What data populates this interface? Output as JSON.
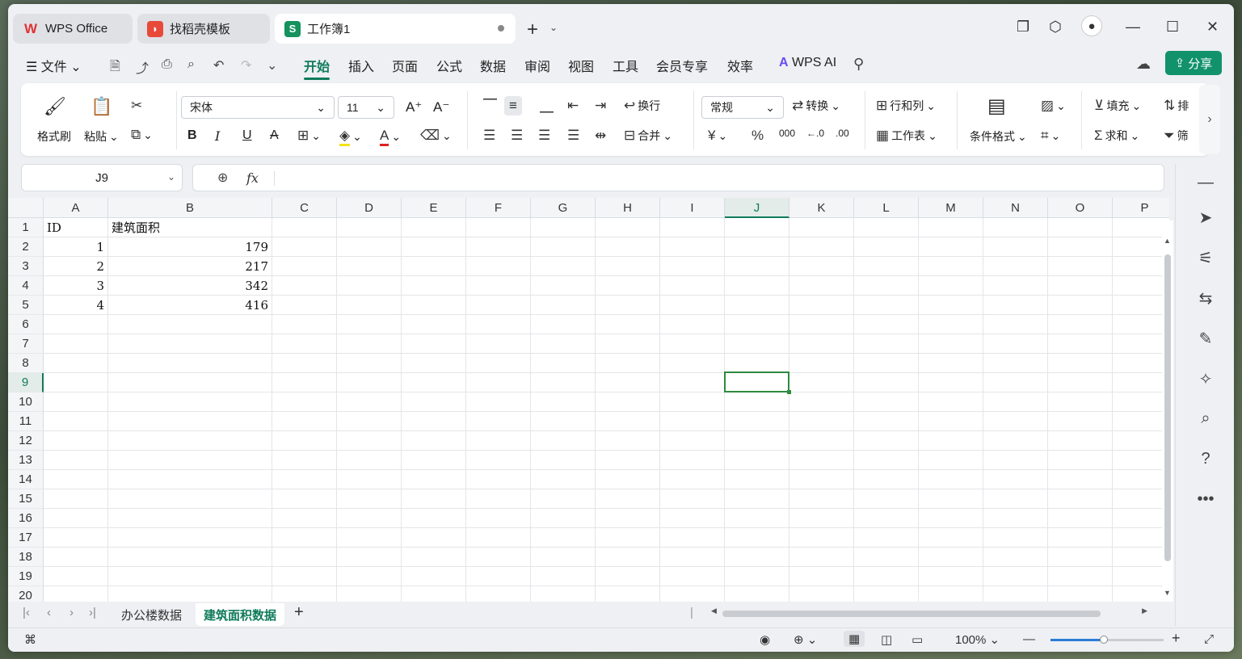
{
  "tabs": [
    {
      "label": "WPS Office",
      "active": false
    },
    {
      "label": "找稻壳模板",
      "active": false
    },
    {
      "label": "工作簿1",
      "active": true
    }
  ],
  "menu": {
    "file_label": "文件",
    "items": [
      "开始",
      "插入",
      "页面",
      "公式",
      "数据",
      "审阅",
      "视图",
      "工具",
      "会员专享",
      "效率"
    ],
    "active": "开始",
    "wps_ai": "WPS AI",
    "share": "分享"
  },
  "ribbon": {
    "format_painter": "格式刷",
    "paste": "粘贴",
    "font_name": "宋体",
    "font_size": "11",
    "wrap": "换行",
    "merge": "合并",
    "number_format": "常规",
    "convert": "转换",
    "rows_cols": "行和列",
    "worksheet": "工作表",
    "cond_format": "条件格式",
    "fill": "填充",
    "sort": "排",
    "sum": "求和",
    "filter": "筛"
  },
  "formula": {
    "name_box": "J9",
    "fx": "fx",
    "content": ""
  },
  "grid": {
    "columns": [
      "A",
      "B",
      "C",
      "D",
      "E",
      "F",
      "G",
      "H",
      "I",
      "J",
      "K",
      "L",
      "M",
      "N",
      "O",
      "P"
    ],
    "selected_column": "J",
    "rows": [
      "1",
      "2",
      "3",
      "4",
      "5",
      "6",
      "7",
      "8",
      "9",
      "10",
      "11",
      "12",
      "13",
      "14",
      "15",
      "16",
      "17",
      "18",
      "19",
      "20"
    ],
    "selected_row": "9",
    "cells": {
      "A1": "ID",
      "B1": "建筑面积",
      "A2": "1",
      "B2": "179",
      "A3": "2",
      "B3": "217",
      "A4": "3",
      "B4": "342",
      "A5": "4",
      "B5": "416"
    }
  },
  "sheets": [
    {
      "label": "办公楼数据",
      "active": false
    },
    {
      "label": "建筑面积数据",
      "active": true
    }
  ],
  "status": {
    "zoom": "100%",
    "zoom_fraction": 0.47
  },
  "colors": {
    "accent": "#0f7b5a",
    "share_bg": "#11926a",
    "selection": "#2d8a3f"
  }
}
